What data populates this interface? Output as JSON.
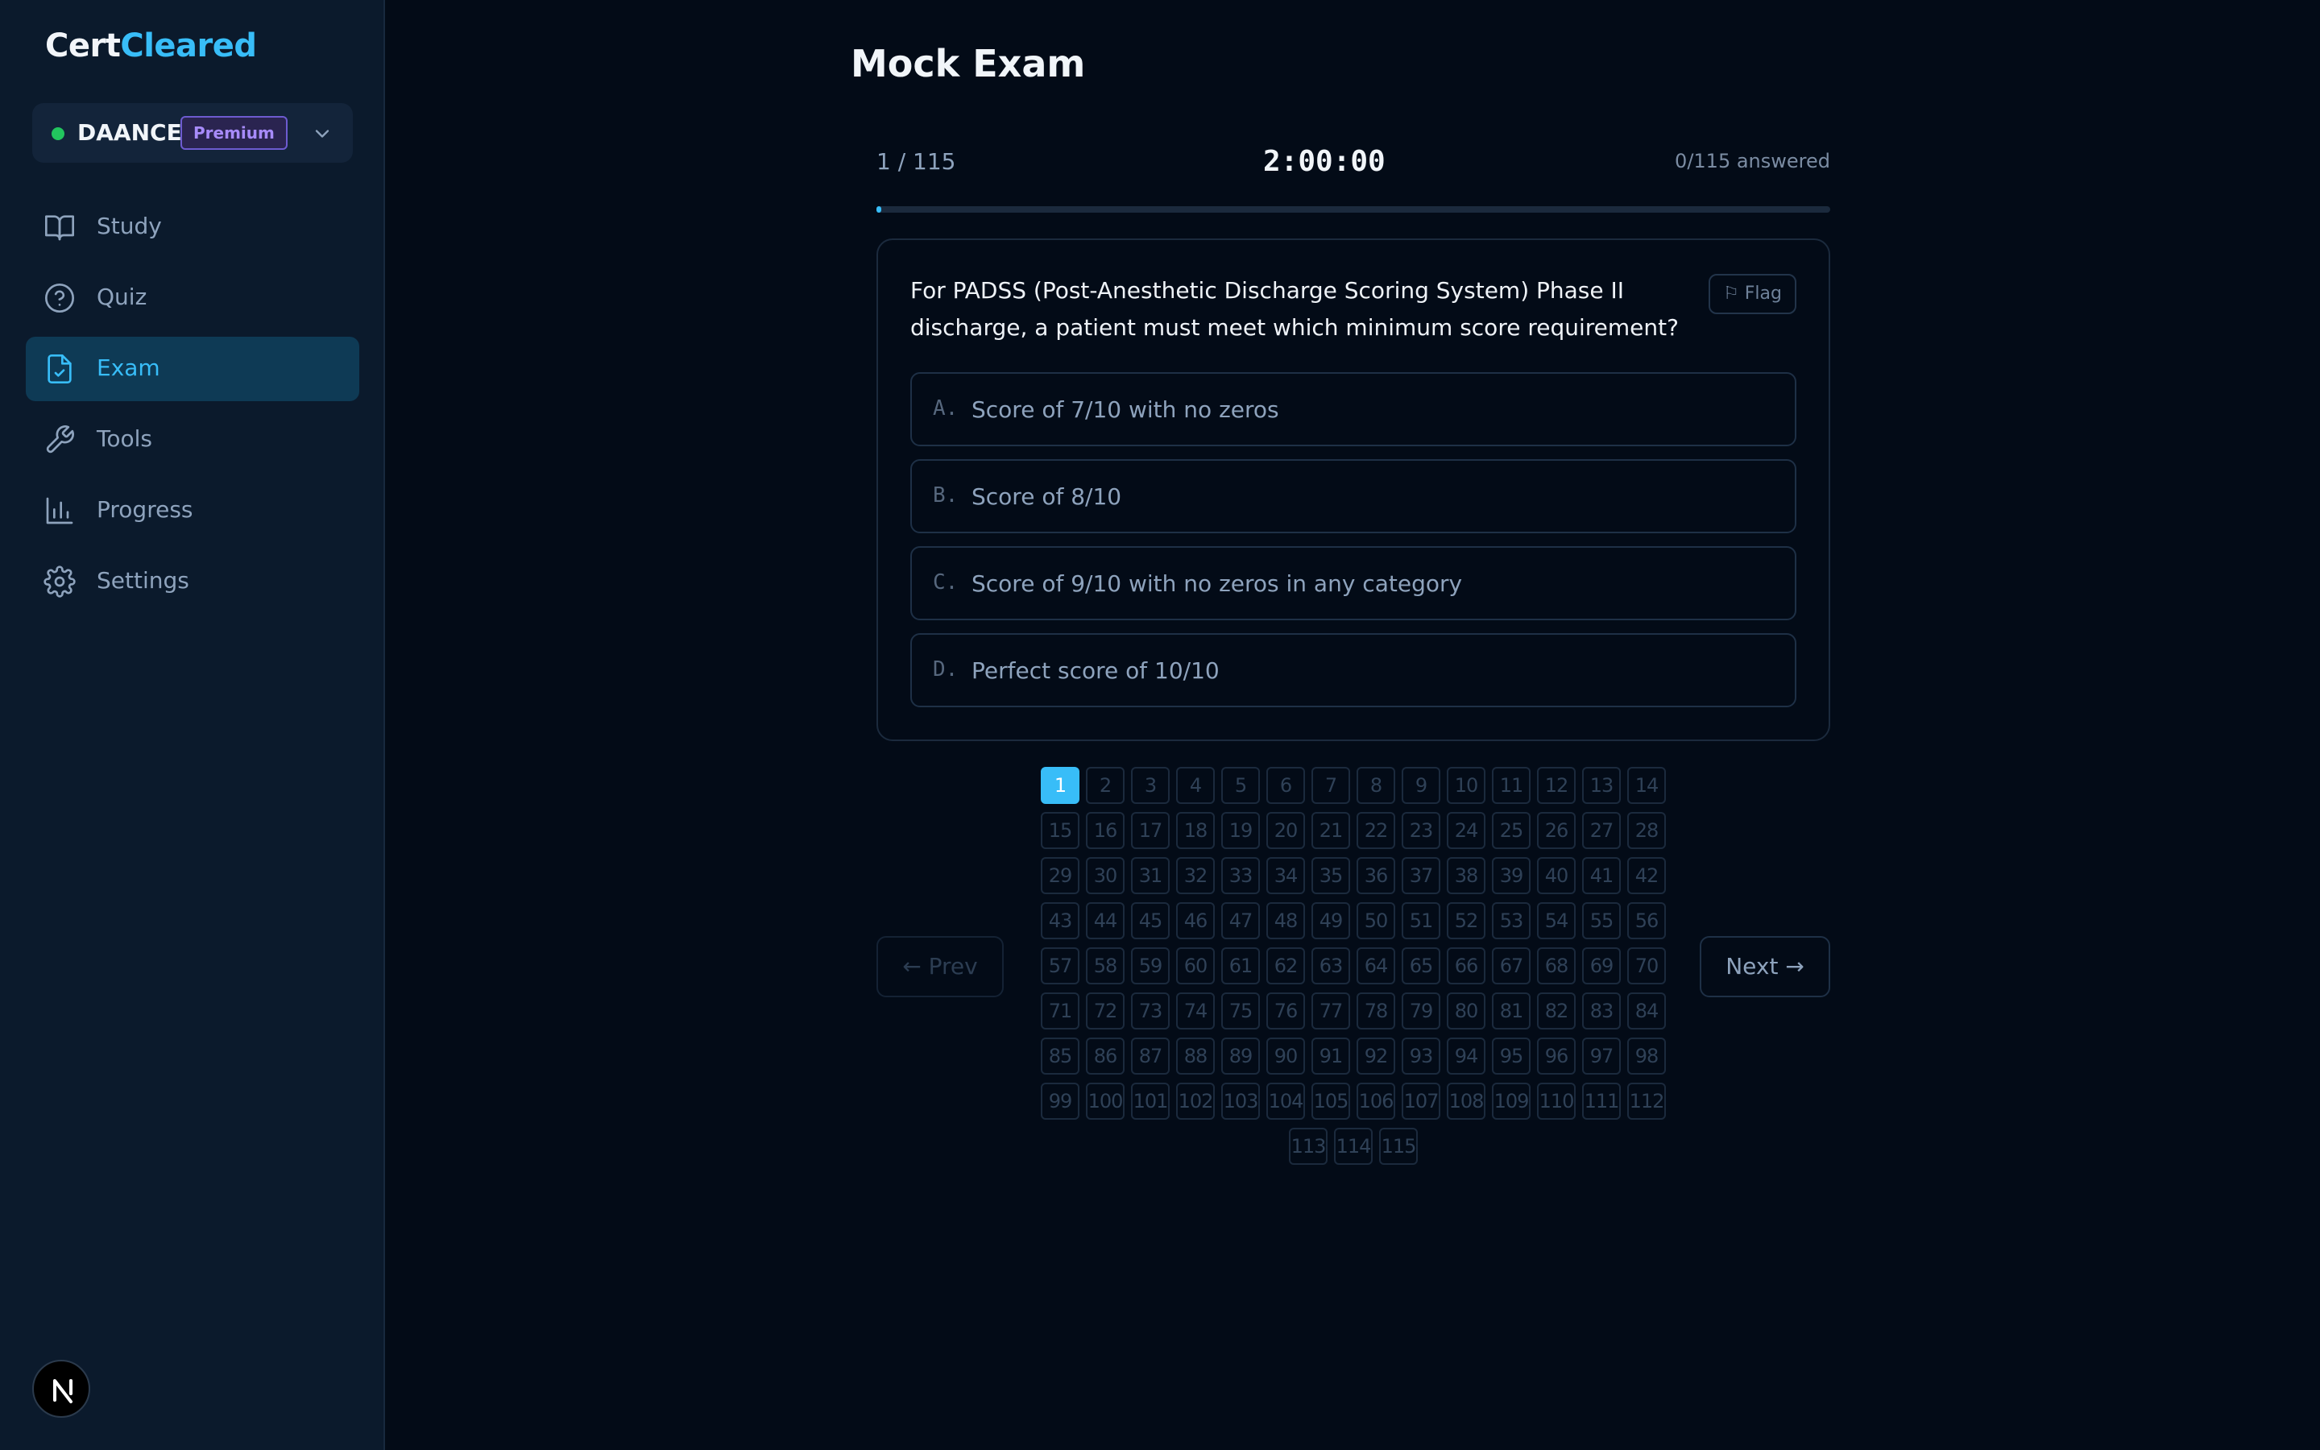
{
  "brand": {
    "part1": "Cert",
    "part2": "Cleared"
  },
  "workspace": {
    "name": "DAANCE",
    "badge": "Premium",
    "status_color": "#22c55e"
  },
  "sidebar": {
    "items": [
      {
        "label": "Study",
        "icon": "book-icon",
        "active": false
      },
      {
        "label": "Quiz",
        "icon": "question-circle-icon",
        "active": false
      },
      {
        "label": "Exam",
        "icon": "file-check-icon",
        "active": true
      },
      {
        "label": "Tools",
        "icon": "wrench-icon",
        "active": false
      },
      {
        "label": "Progress",
        "icon": "bar-chart-icon",
        "active": false
      },
      {
        "label": "Settings",
        "icon": "gear-icon",
        "active": false
      }
    ]
  },
  "page": {
    "title": "Mock Exam"
  },
  "exam": {
    "counter": "1 / 115",
    "timer": "2:00:00",
    "answered": "0/115 answered",
    "progress_fraction": 0.005,
    "current_question": 1,
    "total_questions": 115
  },
  "question": {
    "text": "For PADSS (Post-Anesthetic Discharge Scoring System) Phase II discharge, a patient must meet which minimum score requirement?",
    "flag_label": "⚐ Flag",
    "options": [
      {
        "letter": "A.",
        "text": "Score of 7/10 with no zeros"
      },
      {
        "letter": "B.",
        "text": "Score of 8/10"
      },
      {
        "letter": "C.",
        "text": "Score of 9/10 with no zeros in any category"
      },
      {
        "letter": "D.",
        "text": "Perfect score of 10/10"
      }
    ]
  },
  "navigation": {
    "prev_label": "← Prev",
    "next_label": "Next →"
  },
  "colors": {
    "accent": "#38bdf8",
    "background": "#030b17",
    "sidebar": "#0b1a2c"
  }
}
